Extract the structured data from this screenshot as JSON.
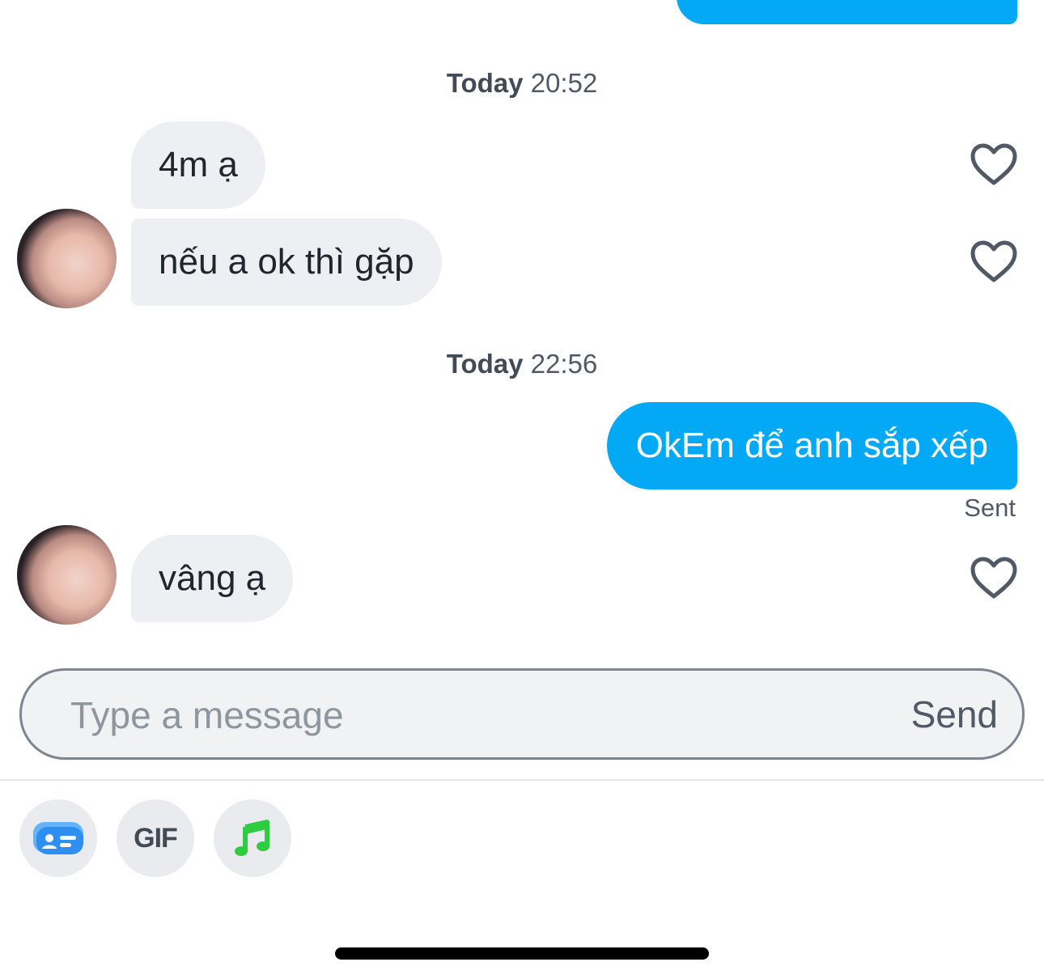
{
  "conversation": {
    "groups": [
      {
        "date_label": "Today",
        "time": "20:52"
      },
      {
        "date_label": "Today",
        "time": "22:56"
      }
    ],
    "messages": [
      {
        "text": "4m ạ"
      },
      {
        "text": "nếu a ok thì gặp"
      },
      {
        "text": "OkEm để anh sắp xếp",
        "status": "Sent"
      },
      {
        "text": "vâng ạ"
      }
    ]
  },
  "composer": {
    "placeholder": "Type a message",
    "send_label": "Send"
  },
  "toolbar": {
    "gif_label": "GIF",
    "icons": [
      "id-card-icon",
      "gif-icon",
      "music-note-icon"
    ]
  },
  "colors": {
    "outgoing_bubble": "#03a9f4",
    "incoming_bubble": "#eeeff3",
    "music_icon": "#2ecc40",
    "card_icon": "#3b9ff6"
  }
}
